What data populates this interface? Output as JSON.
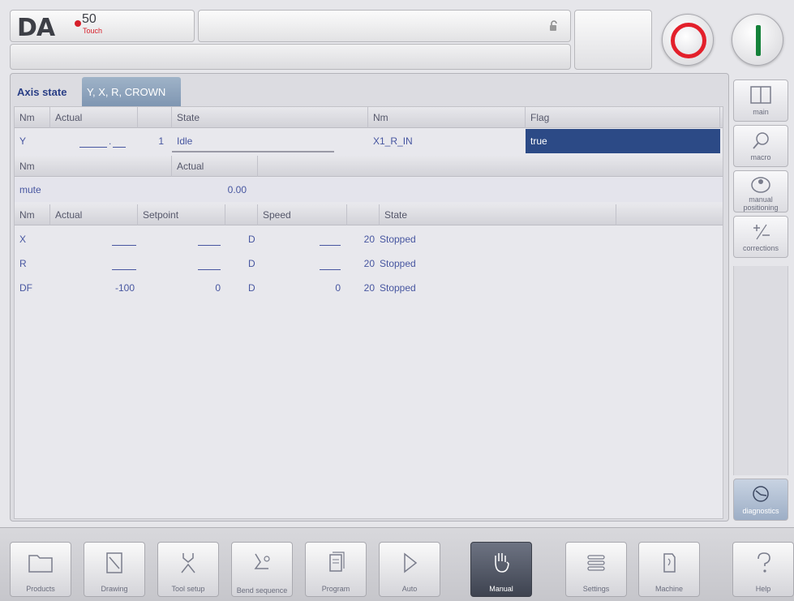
{
  "header": {
    "logo_text": "DA",
    "logo_number": "50",
    "logo_sub": "Touch",
    "title": "",
    "status": ""
  },
  "tabs": [
    {
      "label": "Axis state"
    },
    {
      "label": "Y, X, R, CROWN"
    }
  ],
  "table1": {
    "headers": [
      "Nm",
      "Actual",
      "",
      "State",
      "Nm",
      "Flag"
    ],
    "row": {
      "nm": "Y",
      "actual": "1",
      "state": "Idle",
      "flag_nm": "X1_R_IN",
      "flag": "true"
    }
  },
  "table2": {
    "headers": [
      "Nm",
      "Actual"
    ],
    "row": {
      "nm": "mute",
      "actual": "0.00"
    }
  },
  "table3": {
    "headers": [
      "Nm",
      "Actual",
      "Setpoint",
      "",
      "Speed",
      "",
      "State"
    ],
    "rows": [
      {
        "nm": "X",
        "actual": "",
        "setpoint": "",
        "dir": "D",
        "speed": "",
        "pct": "20",
        "state": "Stopped"
      },
      {
        "nm": "R",
        "actual": "",
        "setpoint": "",
        "dir": "D",
        "speed": "",
        "pct": "20",
        "state": "Stopped"
      },
      {
        "nm": "DF",
        "actual": "-100",
        "setpoint": "0",
        "dir": "D",
        "speed": "0",
        "pct": "20",
        "state": "Stopped"
      }
    ]
  },
  "sidebar": [
    {
      "label": "main",
      "icon": "panels-icon"
    },
    {
      "label": "macro",
      "icon": "magnifier-icon"
    },
    {
      "label": "manual positioning",
      "icon": "positioning-icon"
    },
    {
      "label": "corrections",
      "icon": "plus-minus-icon"
    },
    {
      "label": "diagnostics",
      "icon": "diagnostics-icon"
    }
  ],
  "bottom_nav": [
    {
      "label": "Products",
      "icon": "folder-icon"
    },
    {
      "label": "Drawing",
      "icon": "drawing-icon"
    },
    {
      "label": "Tool setup",
      "icon": "tool-icon"
    },
    {
      "label": "Bend sequence",
      "icon": "bend-icon"
    },
    {
      "label": "Program",
      "icon": "program-icon"
    },
    {
      "label": "Auto",
      "icon": "play-icon"
    },
    {
      "label": "Manual",
      "icon": "hand-icon"
    },
    {
      "label": "Settings",
      "icon": "list-icon"
    },
    {
      "label": "Machine",
      "icon": "machine-icon"
    },
    {
      "label": "Help",
      "icon": "question-icon"
    }
  ],
  "colors": {
    "accent": "#2c4a86",
    "stop": "#e3202b",
    "start": "#15823a",
    "text": "#4756a0"
  }
}
